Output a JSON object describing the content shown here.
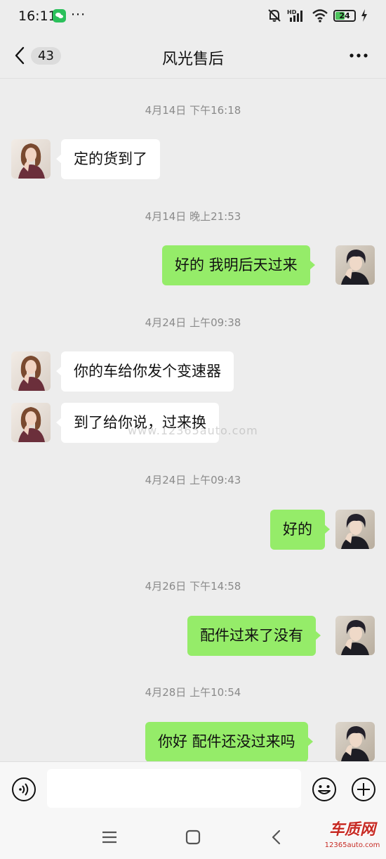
{
  "status_bar": {
    "time": "16:11",
    "more": "···",
    "battery_level": "24",
    "icons": [
      "wechat-icon",
      "mute-bell-icon",
      "hd-signal-icon",
      "wifi-icon",
      "battery-icon",
      "charging-icon"
    ]
  },
  "header": {
    "unread_count": "43",
    "title": "风光售后",
    "icons": [
      "chevron-left-icon",
      "more-icon"
    ]
  },
  "messages": [
    {
      "type": "time",
      "text": "4月14日 下午16:18"
    },
    {
      "type": "msg",
      "side": "left",
      "text": "定的货到了"
    },
    {
      "type": "time",
      "text": "4月14日 晚上21:53"
    },
    {
      "type": "msg",
      "side": "right",
      "text": "好的  我明后天过来"
    },
    {
      "type": "time",
      "text": "4月24日 上午09:38"
    },
    {
      "type": "msg",
      "side": "left",
      "text": "你的车给你发个变速器"
    },
    {
      "type": "msg",
      "side": "left",
      "text": "到了给你说，过来换"
    },
    {
      "type": "time",
      "text": "4月24日 上午09:43"
    },
    {
      "type": "msg",
      "side": "right",
      "text": "好的"
    },
    {
      "type": "time",
      "text": "4月26日 下午14:58"
    },
    {
      "type": "msg",
      "side": "right",
      "text": "配件过来了没有"
    },
    {
      "type": "time",
      "text": "4月28日 上午10:54"
    },
    {
      "type": "msg",
      "side": "right",
      "text": "你好  配件还没过来吗"
    }
  ],
  "watermark": "www.12365auto.com",
  "input_bar": {
    "value": "",
    "placeholder": "",
    "icons": [
      "voice-icon",
      "emoji-icon",
      "plus-icon"
    ]
  },
  "nav_bar": {
    "icons": [
      "menu-icon",
      "home-icon",
      "back-icon"
    ]
  },
  "site_logo": {
    "main": "车质网",
    "sub": "12365auto.com"
  },
  "colors": {
    "background": "#ededed",
    "sent_bubble": "#95ec69",
    "received_bubble": "#ffffff",
    "timestamp_text": "#8a8a8a",
    "logo_red": "#c72b24"
  }
}
